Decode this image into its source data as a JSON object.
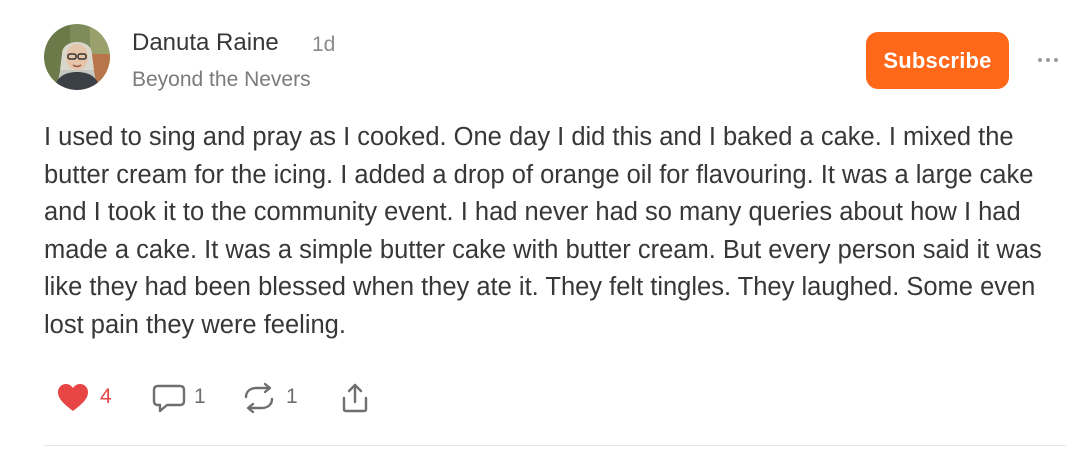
{
  "author": {
    "name": "Danuta Raine",
    "time": "1d",
    "publication": "Beyond the Nevers"
  },
  "subscribe_label": "Subscribe",
  "body": "I used to sing and pray as I cooked. One day I did this and I baked a cake. I mixed the butter cream for the icing. I added a drop of orange oil for flavouring. It was a large cake and I took it to the community event. I had never had so many queries about how I had made a cake. It was a simple butter cake with butter cream. But every person said it was like they had been blessed when they ate it. They felt tingles. They laughed. Some even lost pain they were feeling.",
  "actions": {
    "likes": "4",
    "comments": "1",
    "restacks": "1"
  },
  "icons": {
    "avatar": "avatar-photo",
    "more": "ellipsis-icon",
    "like": "heart-icon",
    "comment": "comment-bubble-icon",
    "restack": "restack-icon",
    "share": "share-icon"
  },
  "colors": {
    "accent": "#ff6719",
    "like": "#e84545",
    "text": "#363737",
    "muted": "#7b7b7b",
    "divider": "#e6e6e6"
  }
}
